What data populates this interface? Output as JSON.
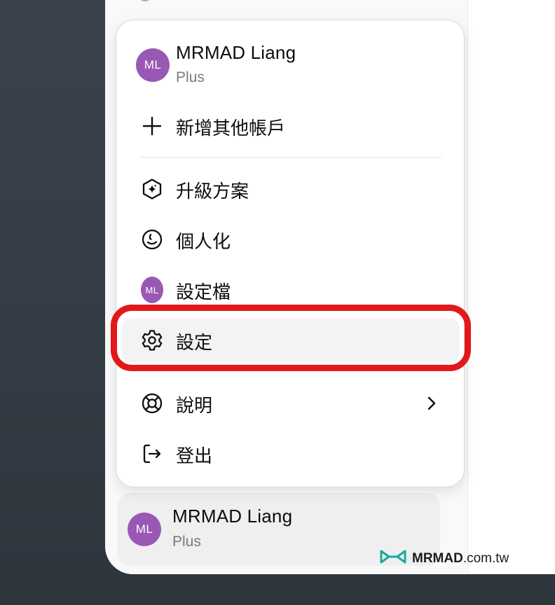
{
  "account": {
    "initials": "ML",
    "name": "MRMAD Liang",
    "plan": "Plus"
  },
  "menu": {
    "items": [
      {
        "key": "add-account",
        "label": "新增其他帳戶",
        "icon": "plus-icon"
      },
      {
        "key": "upgrade",
        "label": "升級方案",
        "icon": "sparkle-hexagon-icon"
      },
      {
        "key": "personalize",
        "label": "個人化",
        "icon": "personalize-icon"
      },
      {
        "key": "profile",
        "label": "設定檔",
        "icon": "avatar"
      },
      {
        "key": "settings",
        "label": "設定",
        "icon": "gear-icon",
        "highlighted": true
      },
      {
        "key": "help",
        "label": "說明",
        "icon": "lifebuoy-icon",
        "has_submenu": true
      },
      {
        "key": "logout",
        "label": "登出",
        "icon": "logout-icon"
      }
    ]
  },
  "sidebar_account": {
    "initials": "ML",
    "name": "MRMAD Liang",
    "plan": "Plus"
  },
  "watermark": {
    "brand": "MRMAD",
    "domain": ".com.tw"
  },
  "colors": {
    "avatar": "#9a58b5",
    "highlight_ring": "#e2181a",
    "logo_teal": "#1aa99a"
  }
}
